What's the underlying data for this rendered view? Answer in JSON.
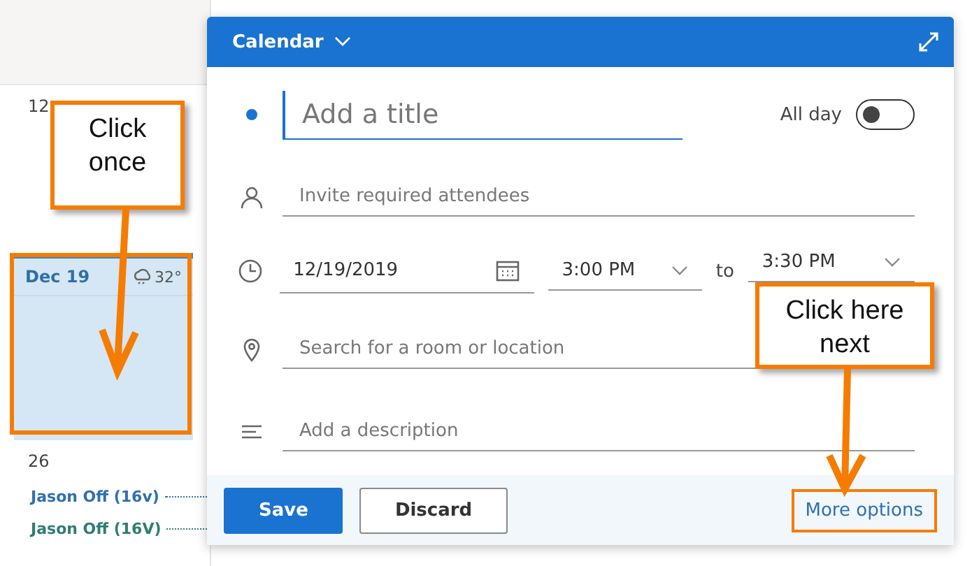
{
  "calendar": {
    "week_1_day": "12",
    "selected_day": {
      "date": "Dec 19",
      "temperature": "32°",
      "selected": true
    },
    "week_2_day": "26",
    "events": [
      {
        "title": "Jason Off (16v)",
        "color": "#2f6fb0"
      },
      {
        "title": "Jason Off (16V)",
        "color": "#2e7d74"
      }
    ]
  },
  "dialog": {
    "calendar_name": "Calendar",
    "title": {
      "placeholder": "Add a title"
    },
    "all_day": {
      "label": "All day",
      "on": false
    },
    "attendees": {
      "placeholder": "Invite required attendees"
    },
    "date": "12/19/2019",
    "start_time": "3:00 PM",
    "to_label": "to",
    "end_time": "3:30 PM",
    "location": {
      "placeholder": "Search for a room or location"
    },
    "description": {
      "placeholder": "Add a description"
    },
    "buttons": {
      "save": "Save",
      "discard": "Discard",
      "more": "More options"
    }
  },
  "annotations": [
    {
      "text": "Click once"
    },
    {
      "text": "Click here next"
    }
  ]
}
